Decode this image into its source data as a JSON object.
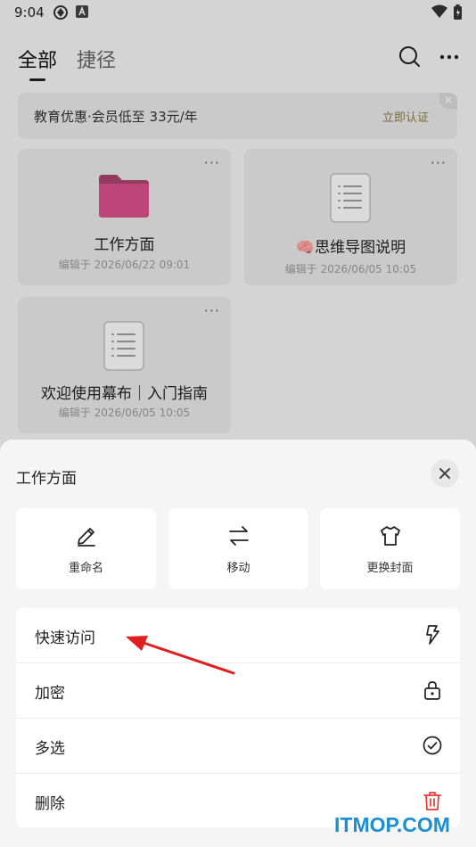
{
  "status": {
    "time": "9:04"
  },
  "tabs": [
    {
      "label": "全部"
    },
    {
      "label": "捷径"
    }
  ],
  "promo": {
    "text": "教育优惠·会员低至 33元/年",
    "link": "立即认证",
    "close": "×"
  },
  "cards": [
    {
      "title": "工作方面",
      "meta": "编辑于 2026/06/22 09:01",
      "more": "···",
      "icon": "folder-icon"
    },
    {
      "title": "思维导图说明",
      "meta": "编辑于 2026/06/05 10:05",
      "more": "···",
      "icon": "document-icon",
      "emoji": "🧠"
    },
    {
      "title": "欢迎使用幕布｜入门指南",
      "meta": "编辑于 2026/06/05 10:05",
      "more": "···",
      "icon": "document-icon"
    }
  ],
  "sheet": {
    "title": "工作方面",
    "actions": [
      {
        "label": "重命名",
        "icon": "pencil-icon"
      },
      {
        "label": "移动",
        "icon": "swap-arrows-icon"
      },
      {
        "label": "更换封面",
        "icon": "shirt-icon"
      }
    ],
    "menu": [
      {
        "label": "快速访问",
        "icon": "lightning-icon"
      },
      {
        "label": "加密",
        "icon": "lock-icon"
      },
      {
        "label": "多选",
        "icon": "check-circle-icon"
      },
      {
        "label": "删除",
        "icon": "trash-icon"
      }
    ]
  },
  "watermark": "ITMOP.COM",
  "colors": {
    "folder": "#e0508a",
    "delete": "#e53935",
    "promo_link": "#8a7a3a",
    "arrow": "#e02020",
    "watermark": "#1c8fd2"
  }
}
